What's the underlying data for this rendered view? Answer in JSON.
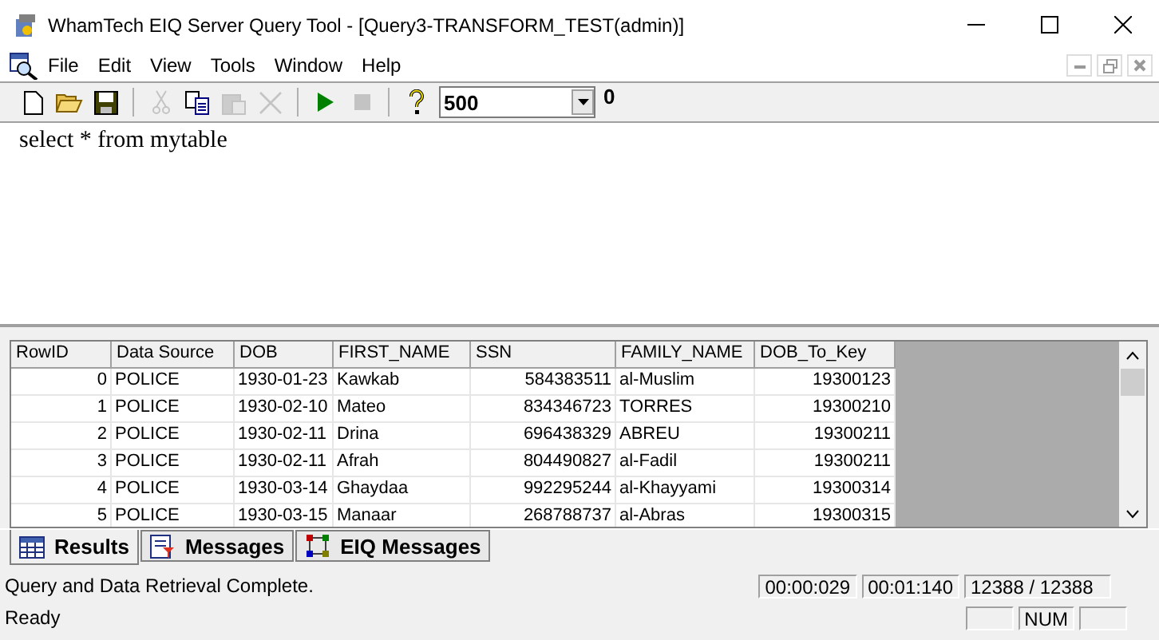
{
  "window": {
    "title": "WhamTech EIQ Server Query Tool - [Query3-TRANSFORM_TEST(admin)]"
  },
  "menu": [
    "File",
    "Edit",
    "View",
    "Tools",
    "Window",
    "Help"
  ],
  "toolbar": [
    {
      "kind": "new",
      "disabled": false
    },
    {
      "kind": "open",
      "disabled": false
    },
    {
      "kind": "save",
      "disabled": false
    },
    {
      "kind": "sep"
    },
    {
      "kind": "cut",
      "disabled": true
    },
    {
      "kind": "copy",
      "disabled": false
    },
    {
      "kind": "paste",
      "disabled": true
    },
    {
      "kind": "delete",
      "disabled": true
    },
    {
      "kind": "sep"
    },
    {
      "kind": "run",
      "disabled": false
    },
    {
      "kind": "stop",
      "disabled": true
    },
    {
      "kind": "sep"
    },
    {
      "kind": "help",
      "disabled": false
    }
  ],
  "row_limit": "500",
  "row_count": "0",
  "editor": {
    "value": "select * from mytable"
  },
  "table": {
    "columns": [
      "RowID",
      "Data Source",
      "DOB",
      "FIRST_NAME",
      "SSN",
      "FAMILY_NAME",
      "DOB_To_Key"
    ],
    "rows": [
      [
        "0",
        "POLICE",
        "1930-01-23",
        "Kawkab",
        "584383511",
        "al-Muslim",
        "19300123"
      ],
      [
        "1",
        "POLICE",
        "1930-02-10",
        "Mateo",
        "834346723",
        "TORRES",
        "19300210"
      ],
      [
        "2",
        "POLICE",
        "1930-02-11",
        "Drina",
        "696438329",
        "ABREU",
        "19300211"
      ],
      [
        "3",
        "POLICE",
        "1930-02-11",
        "Afrah",
        "804490827",
        "al-Fadil",
        "19300211"
      ],
      [
        "4",
        "POLICE",
        "1930-03-14",
        "Ghaydaa",
        "992295244",
        "al-Khayyami",
        "19300314"
      ],
      [
        "5",
        "POLICE",
        "1930-03-15",
        "Manaar",
        "268788737",
        "al-Abras",
        "19300315"
      ]
    ]
  },
  "tabs": [
    {
      "label": "Results",
      "kind": "grid",
      "selected": true
    },
    {
      "label": "Messages",
      "kind": "messages",
      "selected": false
    },
    {
      "label": "EIQ Messages",
      "kind": "eiq",
      "selected": false
    }
  ],
  "query_status": {
    "message": "Query and Data Retrieval Complete.",
    "fields": [
      "00:00:029",
      "00:01:140",
      "12388 / 12388"
    ]
  },
  "status_bar": {
    "text": "Ready",
    "indicators": [
      "NUM"
    ]
  }
}
